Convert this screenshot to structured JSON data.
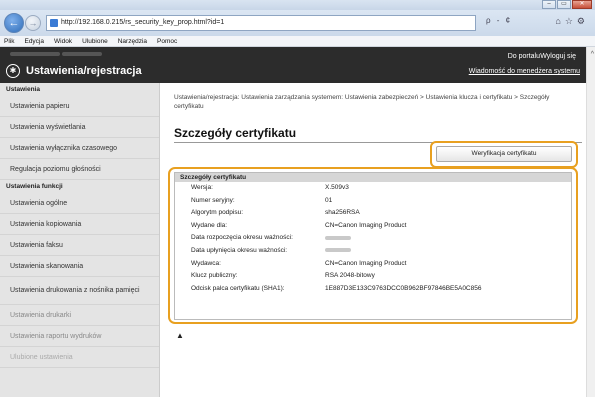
{
  "browser": {
    "address": "http://192.168.0.215/rs_security_key_prop.html?id=1",
    "search_hint": "ρ - ¢",
    "window_controls": [
      "–",
      "▭",
      "✕"
    ],
    "menu": [
      "Plik",
      "Edycja",
      "Widok",
      "Ulubione",
      "Narzędzia",
      "Pomoc"
    ]
  },
  "app": {
    "title": "Ustawienia/rejestracja",
    "portal_link": "Do portalu",
    "logout_link": "Wyloguj się",
    "messages_link": "Wiadomość do menedżera systemu"
  },
  "sidebar": {
    "section1": "Ustawienia",
    "items1": [
      "Ustawienia papieru",
      "Ustawienia wyświetlania",
      "Ustawienia wyłącznika czasowego",
      "Regulacja poziomu głośności"
    ],
    "section2": "Ustawienia funkcji",
    "items2": [
      "Ustawienia ogólne",
      "Ustawienia kopiowania",
      "Ustawienia faksu",
      "Ustawienia skanowania",
      "Ustawienia drukowania z nośnika pamięci",
      "Ustawienia drukarki",
      "Ustawienia raportu wydruków",
      "Ulubione ustawienia"
    ]
  },
  "main": {
    "breadcrumb": "Ustawienia/rejestracja: Ustawienia zarządzania systemem: Ustawienia zabezpieczeń > Ustawienia klucza i certyfikatu > Szczegóły certyfikatu",
    "heading": "Szczegóły certyfikatu",
    "verify_button": "Weryfikacja certyfikatu",
    "top_link": "▲"
  },
  "certificate": {
    "header": "Szczegóły certyfikatu",
    "rows": [
      {
        "label": "Wersja:",
        "value": "X.509v3"
      },
      {
        "label": "Numer seryjny:",
        "value": "01"
      },
      {
        "label": "Algorytm podpisu:",
        "value": "sha256RSA"
      },
      {
        "label": "Wydane dla:",
        "value": "CN=Canon Imaging Product"
      },
      {
        "label": "Data rozpoczęcia okresu ważności:",
        "value": ""
      },
      {
        "label": "Data upłynięcia okresu ważności:",
        "value": ""
      },
      {
        "label": "Wydawca:",
        "value": "CN=Canon Imaging Product"
      },
      {
        "label": "Klucz publiczny:",
        "value": "RSA 2048-bitowy"
      },
      {
        "label": "Odcisk palca certyfikatu (SHA1):",
        "value": "1E887D3E133C9763DCC0B962BF97846BE5A0C856"
      }
    ]
  },
  "colors": {
    "highlight": "#e8a020",
    "header_bg": "#2c2c2c",
    "sidebar_bg": "#e4e4e4"
  }
}
